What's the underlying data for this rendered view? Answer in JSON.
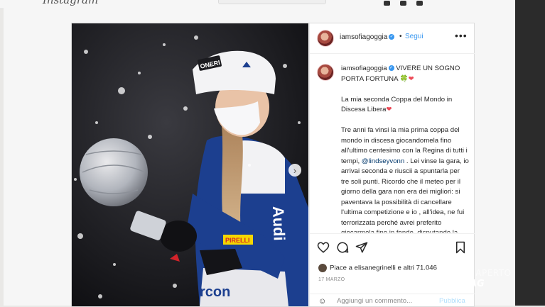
{
  "app": {
    "logo_text": "Instagram"
  },
  "colors": {
    "accent": "#3897f0",
    "mention": "#00376b",
    "heart": "#ed4956",
    "clover": "#2ba84a"
  },
  "post": {
    "username": "iamsofiagoggia",
    "follow_label": "Segui",
    "more_label": "•••",
    "caption": {
      "username": "iamsofiagoggia",
      "title": "VIVERE UN SOGNO PORTA FORTUNA",
      "title_emoji": "🍀❤",
      "para1": "La mia seconda Coppa del Mondo in Discesa Libera",
      "para1_emoji": "❤",
      "para2_a": "Tre anni fa vinsi la mia prima coppa del mondo in discesa giocandomela fino all'ultimo centesimo con la Regina di tutti i tempi, ",
      "mention": "@lindseyvonn",
      "para2_b": " . Lei vinse la gara, io arrivai seconda e riuscii a spuntarla per tre soli punti. Ricordo che il meteo per il giorno della gara non era dei migliori: si paventava la possibilità di cancellare l'ultima competizione e io , all'idea, ne fui terrorizzata perché avrei preferito giocarmela fino in fondo, disputando la gara, lasciando che le nostre capacità sciistiche decretassero la"
    },
    "likes": {
      "prefix": "Piace a ",
      "user": "elisanegrinelli",
      "middle": " e ",
      "count": "altri 71.046"
    },
    "date": "17 MARZO",
    "comment_placeholder": "Aggiungi un commento...",
    "publish_label": "Pubblica"
  },
  "photo": {
    "headband_text": "ONERI",
    "brand_text": "Audi",
    "sponsor_text": "PIRELLI",
    "bib_text": "rcon"
  },
  "watermark": {
    "line1": "STUDIO APERTO",
    "line2": "MAG"
  },
  "icons": [
    "heart-icon",
    "comment-icon",
    "share-icon",
    "bookmark-icon",
    "verified-icon",
    "more-icon",
    "chevron-right-icon",
    "emoji-icon"
  ]
}
